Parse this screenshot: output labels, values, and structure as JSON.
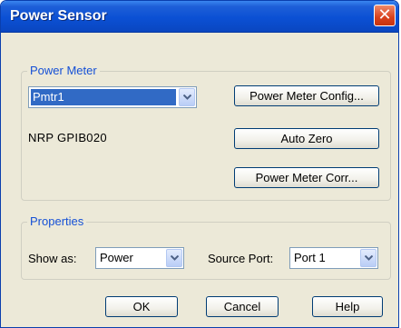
{
  "window": {
    "title": "Power Sensor"
  },
  "power_meter": {
    "group_label": "Power Meter",
    "meter_select": {
      "value": "Pmtr1"
    },
    "device_info": "NRP  GPIB020",
    "config_button": "Power Meter Config...",
    "auto_zero_button": "Auto Zero",
    "correction_button": "Power Meter Corr..."
  },
  "properties": {
    "group_label": "Properties",
    "show_as_label": "Show as:",
    "show_as_value": "Power",
    "source_port_label": "Source Port:",
    "source_port_value": "Port 1"
  },
  "footer": {
    "ok_button": "OK",
    "cancel_button": "Cancel",
    "help_button": "Help"
  },
  "icons": {
    "close": "close-icon",
    "dropdown": "chevron-down-icon"
  },
  "colors": {
    "titlebar": "#0b50d4",
    "group_label": "#1550d6",
    "selection": "#316ac5",
    "dialog_bg": "#ece9d8"
  }
}
